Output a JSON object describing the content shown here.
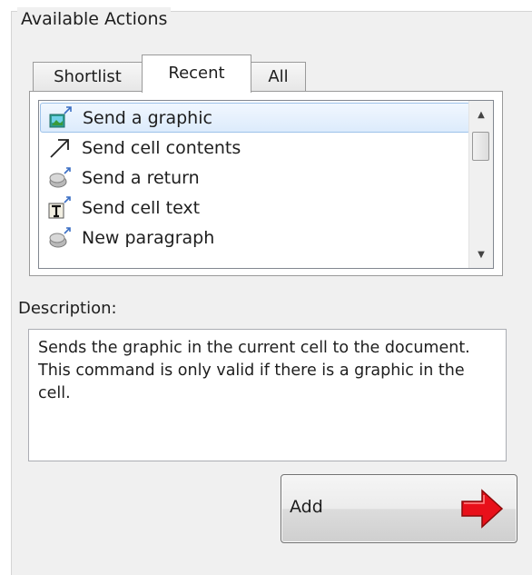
{
  "group": {
    "title": "Available Actions"
  },
  "tabs": [
    {
      "label": "Shortlist",
      "active": false
    },
    {
      "label": "Recent",
      "active": true
    },
    {
      "label": "All",
      "active": false
    }
  ],
  "actions_list": {
    "items": [
      {
        "label": "Send a graphic",
        "icon": "graphic-send-icon",
        "selected": true
      },
      {
        "label": "Send cell contents",
        "icon": "arrow-up-right-icon",
        "selected": false
      },
      {
        "label": "Send a return",
        "icon": "stapler-icon",
        "selected": false
      },
      {
        "label": "Send cell text",
        "icon": "text-send-icon",
        "selected": false
      },
      {
        "label": "New paragraph",
        "icon": "stapler-icon",
        "selected": false
      }
    ]
  },
  "description": {
    "label": "Description:",
    "text": "Sends the graphic in the current cell to the document. This command is only valid if there is a graphic in the cell."
  },
  "add_button": {
    "label": "Add",
    "icon": "red-arrow-right-icon"
  },
  "colors": {
    "selection": "#dcebfc",
    "selection_border": "#9dc2ea",
    "arrow_red": "#e8101a"
  }
}
